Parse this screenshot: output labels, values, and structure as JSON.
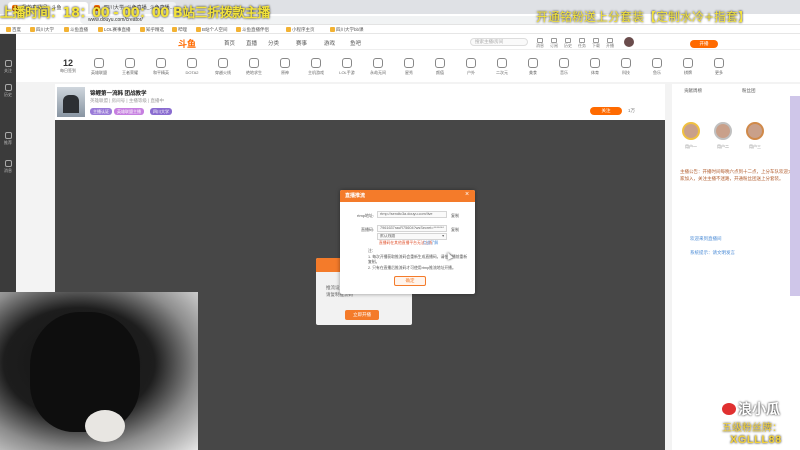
{
  "overlay": {
    "left_banner": "上播时间：18：00 - 00：00 B站三折拨款主播",
    "right_banner": "开通铭粉送上分套装【定制水冷+指套】",
    "brand_name": "浪小瓜",
    "fan_level": "五级粉丝牌：",
    "fan_code": "XGLLL88"
  },
  "browser": {
    "tabs": [
      "我的直播间 - 斗鱼",
      "四川大学_斗鱼直播_斗鱼直播..."
    ],
    "url": "www.douyu.com/creator/",
    "bookmarks": [
      "百度",
      "四川大学",
      "斗鱼直播",
      "LOL赛事直播",
      "知乎精选",
      "哔哩",
      "B站个人空间",
      "斗鱼直播伴侣",
      "小程序主页",
      "四川大学bb课"
    ]
  },
  "site": {
    "logo": "斗鱼",
    "nav": [
      "首页",
      "直播",
      "分类",
      "赛事",
      "游戏",
      "鱼吧"
    ],
    "search_placeholder": "搜索主播/房间",
    "header_icons": [
      "消息",
      "订阅",
      "历史",
      "任务",
      "下载",
      "开播"
    ],
    "live_button": "开播",
    "date_day": "12",
    "date_label": "每日签到",
    "categories": [
      "英雄联盟",
      "王者荣耀",
      "和平精英",
      "DOTA2",
      "穿越火线",
      "绝地求生",
      "原神",
      "主机游戏",
      "LOL手游",
      "永劫无间",
      "星秀",
      "颜值",
      "户外",
      "二次元",
      "美食",
      "音乐",
      "体育",
      "科技",
      "鱼乐",
      "棋牌",
      "更多"
    ]
  },
  "room": {
    "title": "锦鲤第一流韩 团战教学",
    "subtitle": "英雄联盟  |  房间号  |  主播等级  |  直播中",
    "tags": [
      "主播认证",
      "英雄联盟主播",
      "四川大学"
    ],
    "follow_button": "关注",
    "follow_count": "1万"
  },
  "right_panel": {
    "tabs": [
      "贡献周榜",
      "粉丝团"
    ],
    "ranks": [
      "用户一",
      "用户二",
      "用户三"
    ],
    "notice": "主播公告：开播时间每晚六点到十二点，上分车队欢迎大家加入，关注主播不迷路，开通粉丝团送上分套装。",
    "chat": [
      "欢迎来到直播间",
      "系统提示：请文明发言"
    ]
  },
  "rail": [
    "关注",
    "历史",
    "推荐",
    "消息"
  ],
  "bg_dialog": {
    "text_lines": [
      "推流设置",
      "请复制推流码"
    ],
    "button": "立即开播"
  },
  "modal": {
    "title": "直播推流",
    "rtmp_label": "rtmp地址:",
    "rtmp_value": "rtmp://sendtc3a.douyu.com/live",
    "rtmp_copy": "复制",
    "code_label": "直播码:",
    "code_value": "7961637rauR75604?wsSecret=*******",
    "code_copy": "复制",
    "select_value": "默认线路",
    "warn": "直播码在其他直播平台无法上线",
    "learn_more": "点此了解",
    "notes": "注：\n1. 每次开播获取推流码会重新生成直播码，请在重播前重新复制。\n2. 只有在直播后推流码才可使用rtmp推流地址开播。",
    "confirm": "确定"
  }
}
